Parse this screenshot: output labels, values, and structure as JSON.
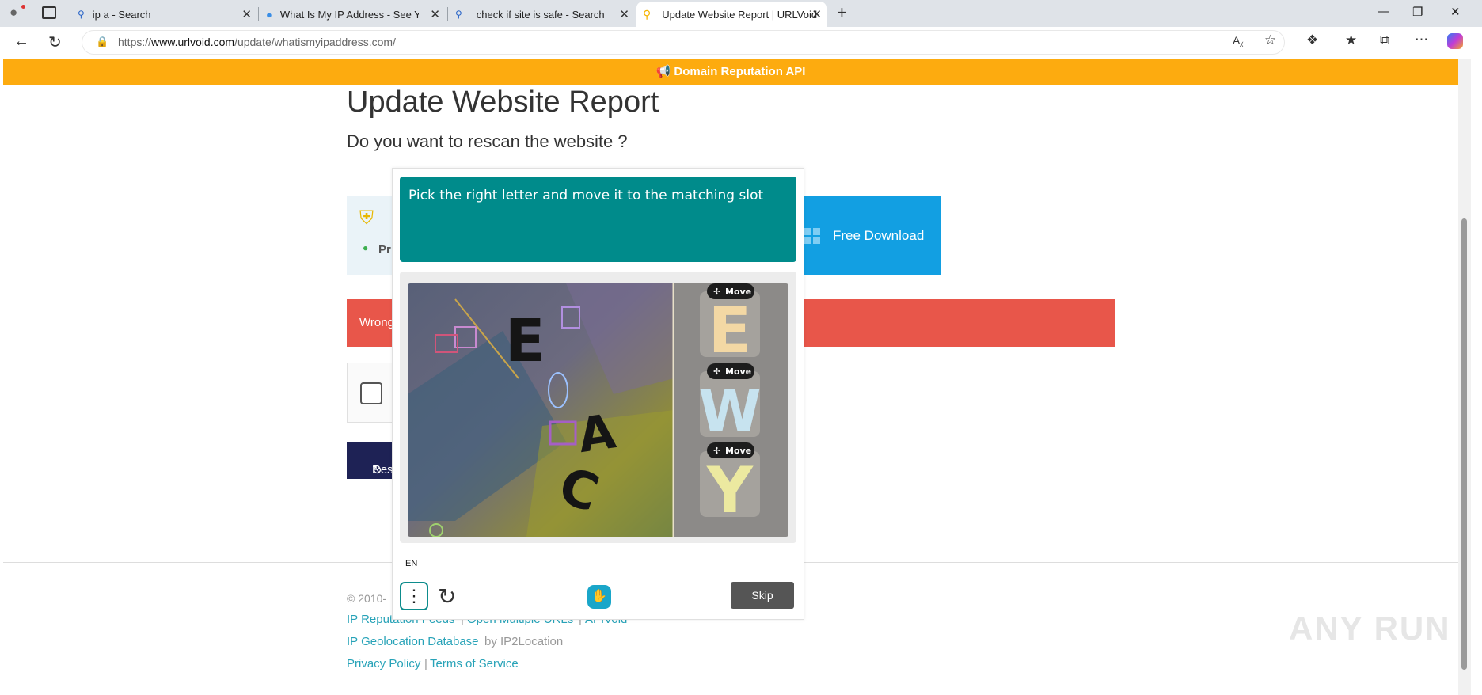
{
  "browser": {
    "tabs": [
      {
        "title": "ip a - Search",
        "icon": "search-icon"
      },
      {
        "title": "What Is My IP Address - See Your",
        "icon": "globe-icon"
      },
      {
        "title": "check if site is safe - Search",
        "icon": "search-icon"
      },
      {
        "title": "Update Website Report | URLVoid",
        "icon": "urlvoid-icon",
        "active": true
      }
    ],
    "url_prefix": "https://",
    "url_domain": "www.urlvoid.com",
    "url_path": "/update/whatismyipaddress.com/"
  },
  "page": {
    "banner": "📢 Domain Reputation API",
    "title": "Update Website Report",
    "subtitle": "Do you want to rescan the website ?",
    "info_fragment": "Pr",
    "download_label": "Free Download",
    "error_fragment": "Wrong",
    "rescan_fragment": "Res",
    "copyright_fragment": "© 2010-",
    "footer_links_1": [
      "IP Reputation Feeds",
      "Open Multiple URLs",
      "APIVoid"
    ],
    "footer_links_2": {
      "link": "IP Geolocation Database",
      "suffix": "by IP2Location"
    },
    "footer_links_3": [
      "Privacy Policy",
      "Terms of Service"
    ],
    "watermark": "ANY RUN"
  },
  "captcha": {
    "prompt": "Pick the right letter and move it to the matching slot",
    "move_label": "Move",
    "options": [
      "E",
      "W",
      "Y"
    ],
    "puzzle_letters": [
      "E",
      "A",
      "C"
    ],
    "language": "EN",
    "skip_label": "Skip",
    "accent": "#008b8b"
  },
  "colors": {
    "banner": "#fdab0f",
    "error": "#e8564a",
    "download": "#129fe2",
    "rescan": "#1e2255"
  }
}
